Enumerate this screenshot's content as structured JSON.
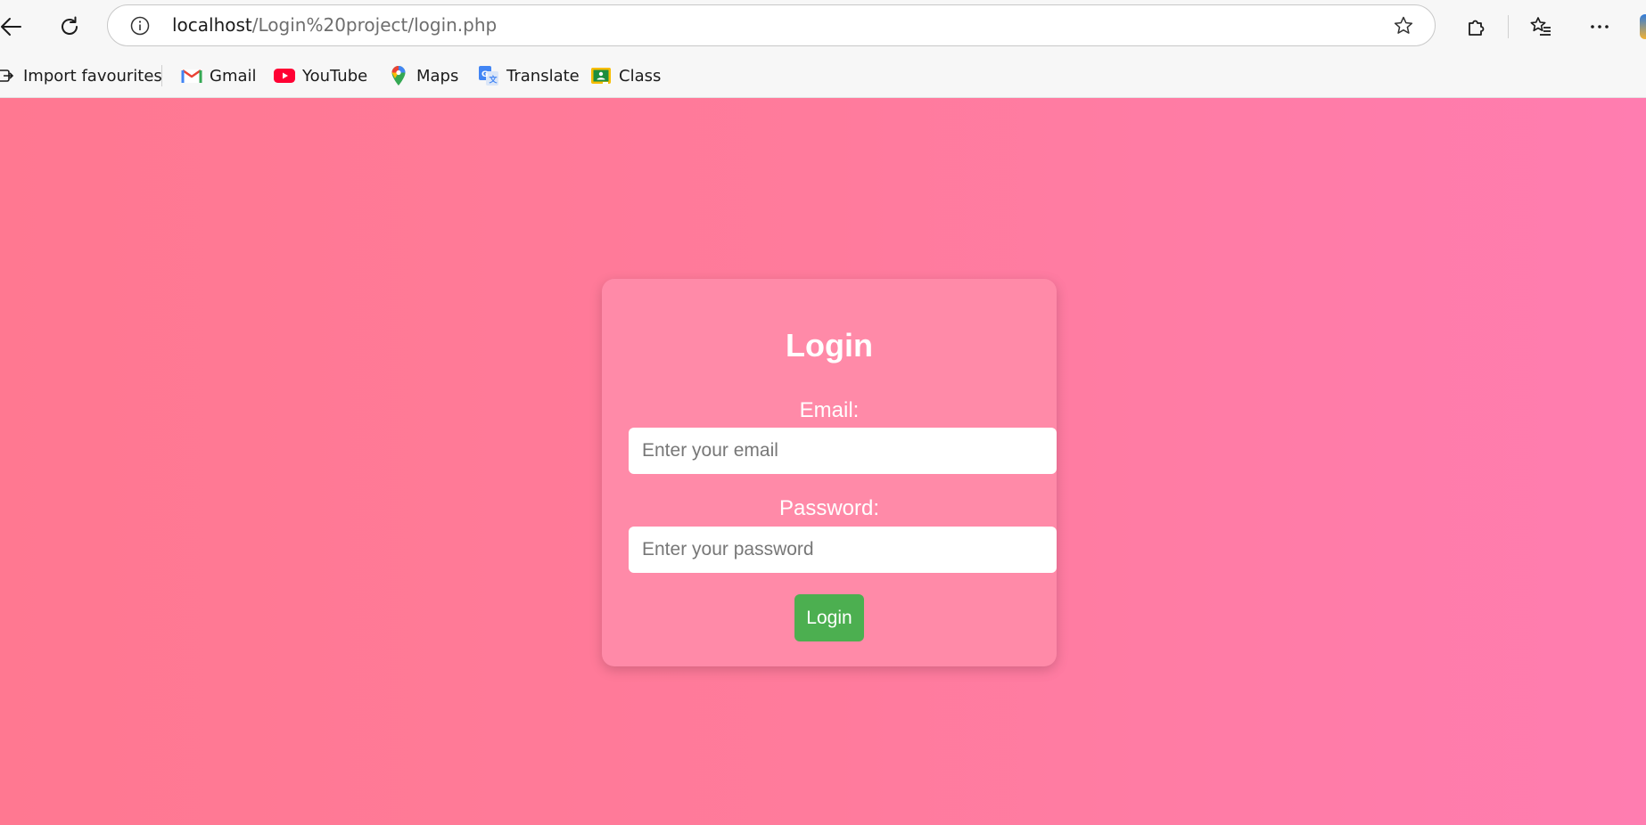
{
  "browser": {
    "url_host": "localhost",
    "url_path": "/Login%20project/login.php",
    "favourites": [
      {
        "label": "Import favourites",
        "icon": "import-icon"
      },
      {
        "label": "Gmail",
        "icon": "gmail-icon"
      },
      {
        "label": "YouTube",
        "icon": "youtube-icon"
      },
      {
        "label": "Maps",
        "icon": "maps-icon"
      },
      {
        "label": "Translate",
        "icon": "translate-icon"
      },
      {
        "label": "Class",
        "icon": "classroom-icon"
      }
    ]
  },
  "login": {
    "title": "Login",
    "email_label": "Email:",
    "email_placeholder": "Enter your email",
    "email_value": "",
    "password_label": "Password:",
    "password_placeholder": "Enter your password",
    "password_value": "",
    "submit_label": "Login"
  },
  "colors": {
    "background_start": "#ff7891",
    "background_end": "#ff7db0",
    "card": "#ff8aa8",
    "button": "#4caf50"
  }
}
